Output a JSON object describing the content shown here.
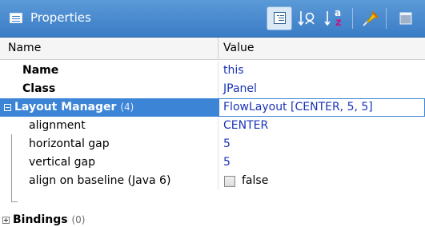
{
  "window": {
    "title": "Properties"
  },
  "toolbar": {
    "icons": [
      "tree-view-icon",
      "filter-icon",
      "sort-az-icon",
      "pin-icon",
      "restore-icon"
    ]
  },
  "table": {
    "headers": {
      "name": "Name",
      "value": "Value"
    },
    "rows": [
      {
        "name": "Name",
        "value": "this"
      },
      {
        "name": "Class",
        "value": "JPanel"
      },
      {
        "name": "Layout Manager",
        "count": "(4)",
        "value": "FlowLayout [CENTER, 5, 5]"
      },
      {
        "name": "alignment",
        "value": "CENTER"
      },
      {
        "name": "horizontal gap",
        "value": "5"
      },
      {
        "name": "vertical gap",
        "value": "5"
      },
      {
        "name": "align on baseline (Java 6)",
        "value": "false",
        "checked": false
      },
      {
        "name": "Bindings",
        "count": "(0)"
      }
    ]
  },
  "colors": {
    "title_bar": "#3a7cc5",
    "selection": "#3b84d6",
    "value_text": "#1a33b8"
  }
}
